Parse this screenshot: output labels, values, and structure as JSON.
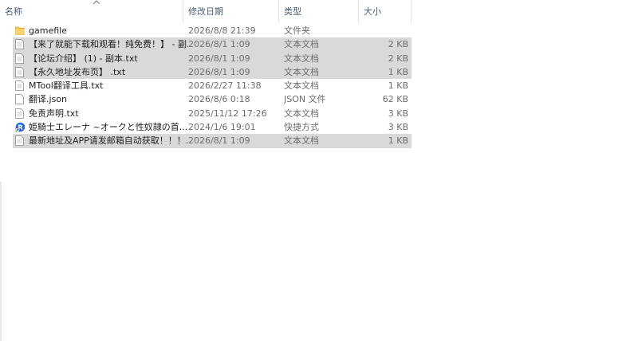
{
  "columns": {
    "name": "名称",
    "date": "修改日期",
    "type": "类型",
    "size": "大小"
  },
  "files": [
    {
      "name": "gamefile",
      "date": "2026/8/8 21:39",
      "type": "文件夹",
      "size": "",
      "icon": "folder-icon",
      "selected": false
    },
    {
      "name": "【来了就能下载和观看！纯免费！】 - 副...",
      "date": "2026/8/1 1:09",
      "type": "文本文档",
      "size": "2 KB",
      "icon": "text-file-icon",
      "selected": true
    },
    {
      "name": "【论坛介绍】 (1) - 副本.txt",
      "date": "2026/8/1 1:09",
      "type": "文本文档",
      "size": "2 KB",
      "icon": "text-file-icon",
      "selected": true
    },
    {
      "name": "【永久地址发布页】 .txt",
      "date": "2026/8/1 1:09",
      "type": "文本文档",
      "size": "1 KB",
      "icon": "text-file-icon",
      "selected": true
    },
    {
      "name": "MTool翻译工具.txt",
      "date": "2026/2/27 11:38",
      "type": "文本文档",
      "size": "1 KB",
      "icon": "text-file-icon",
      "selected": false
    },
    {
      "name": "翻译.json",
      "date": "2026/8/6 0:18",
      "type": "JSON 文件",
      "size": "62 KB",
      "icon": "json-file-icon",
      "selected": false
    },
    {
      "name": "免责声明.txt",
      "date": "2025/11/12 17:26",
      "type": "文本文档",
      "size": "3 KB",
      "icon": "text-file-icon",
      "selected": false
    },
    {
      "name": "姫騎士エレーナ ~オークと性奴隷の首...",
      "date": "2024/1/6 19:01",
      "type": "快捷方式",
      "size": "3 KB",
      "icon": "shortcut-icon",
      "selected": false
    },
    {
      "name": "最新地址及APP请发邮箱自动获取！！！...",
      "date": "2026/8/1 1:09",
      "type": "文本文档",
      "size": "1 KB",
      "icon": "text-file-icon",
      "selected": true
    }
  ]
}
